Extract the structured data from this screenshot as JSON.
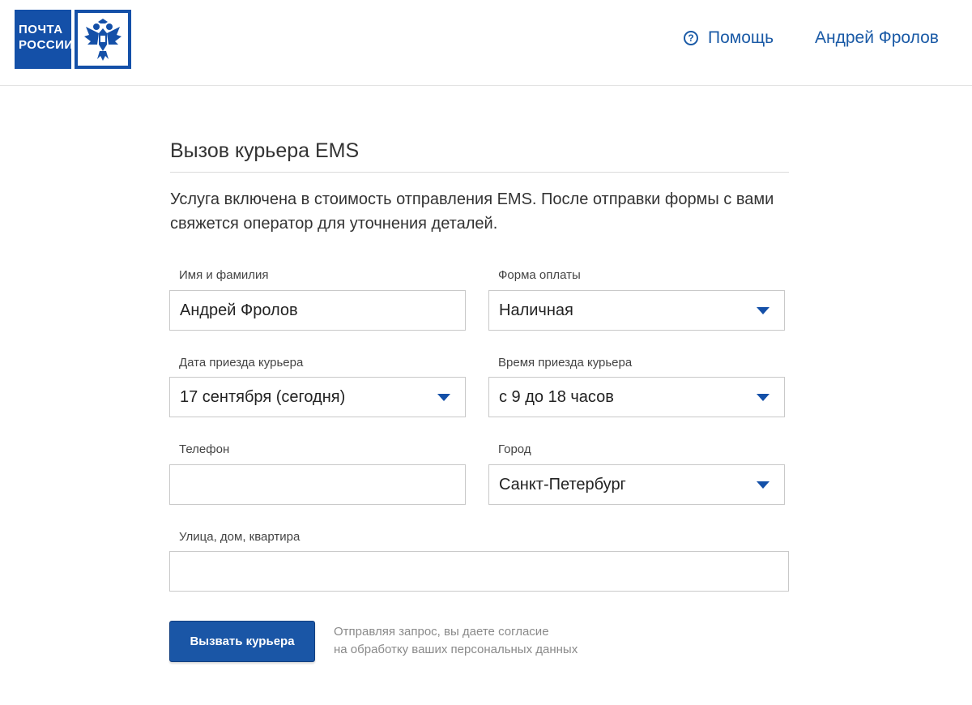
{
  "header": {
    "logo_lines": [
      "ПОЧТА",
      "РОССИИ"
    ],
    "help_label": "Помощь",
    "user_name": "Андрей Фролов"
  },
  "page": {
    "title": "Вызов курьера EMS",
    "description": "Услуга включена в стоимость отправления EMS. После отправки формы с вами свяжется оператор для уточнения деталей."
  },
  "form": {
    "name": {
      "label": "Имя и фамилия",
      "value": "Андрей Фролов"
    },
    "payment": {
      "label": "Форма оплаты",
      "value": "Наличная"
    },
    "date": {
      "label": "Дата приезда курьера",
      "value": "17 сентября (сегодня)"
    },
    "time": {
      "label": "Время приезда курьера",
      "value": "с 9 до 18 часов"
    },
    "phone": {
      "label": "Телефон",
      "value": ""
    },
    "city": {
      "label": "Город",
      "value": "Санкт-Петербург"
    },
    "address": {
      "label": "Улица, дом, квартира",
      "value": ""
    },
    "submit_label": "Вызвать курьера",
    "consent_lines": [
      "Отправляя запрос, вы даете согласие",
      "на обработку ваших персональных данных"
    ]
  },
  "icons": {
    "help": "question-circle-icon",
    "emblem": "double-headed-eagle-icon",
    "dropdown": "caret-down-icon"
  },
  "colors": {
    "brand_blue": "#1450a8",
    "link_blue": "#1a5aa6",
    "button_blue": "#1a56a6"
  }
}
